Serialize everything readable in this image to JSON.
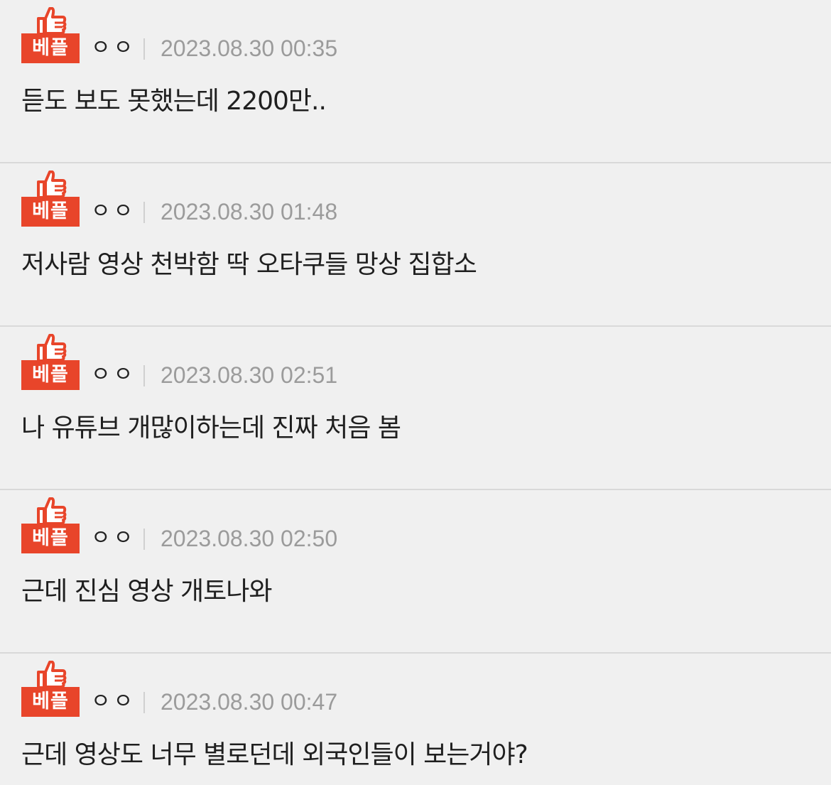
{
  "colors": {
    "background": "#f0f0f0",
    "badge": "#e8452a",
    "divider": "#d9d9d9",
    "date_text": "#9b9b9b",
    "body_text": "#1f1f1f"
  },
  "comments": [
    {
      "badge_label": "베플",
      "badge_icon": "thumbs-up-icon",
      "author": "ㅇㅇ",
      "date": "2023.08.30 00:35",
      "text": "듣도 보도 못했는데 2200만.."
    },
    {
      "badge_label": "베플",
      "badge_icon": "thumbs-up-icon",
      "author": "ㅇㅇ",
      "date": "2023.08.30 01:48",
      "text": "저사람 영상 천박함 딱 오타쿠들 망상 집합소"
    },
    {
      "badge_label": "베플",
      "badge_icon": "thumbs-up-icon",
      "author": "ㅇㅇ",
      "date": "2023.08.30 02:51",
      "text": "나 유튜브 개많이하는데 진짜 처음 봄"
    },
    {
      "badge_label": "베플",
      "badge_icon": "thumbs-up-icon",
      "author": "ㅇㅇ",
      "date": "2023.08.30 02:50",
      "text": "근데 진심 영상 개토나와"
    },
    {
      "badge_label": "베플",
      "badge_icon": "thumbs-up-icon",
      "author": "ㅇㅇ",
      "date": "2023.08.30 00:47",
      "text": "근데 영상도 너무 별로던데 외국인들이 보는거야?"
    }
  ]
}
